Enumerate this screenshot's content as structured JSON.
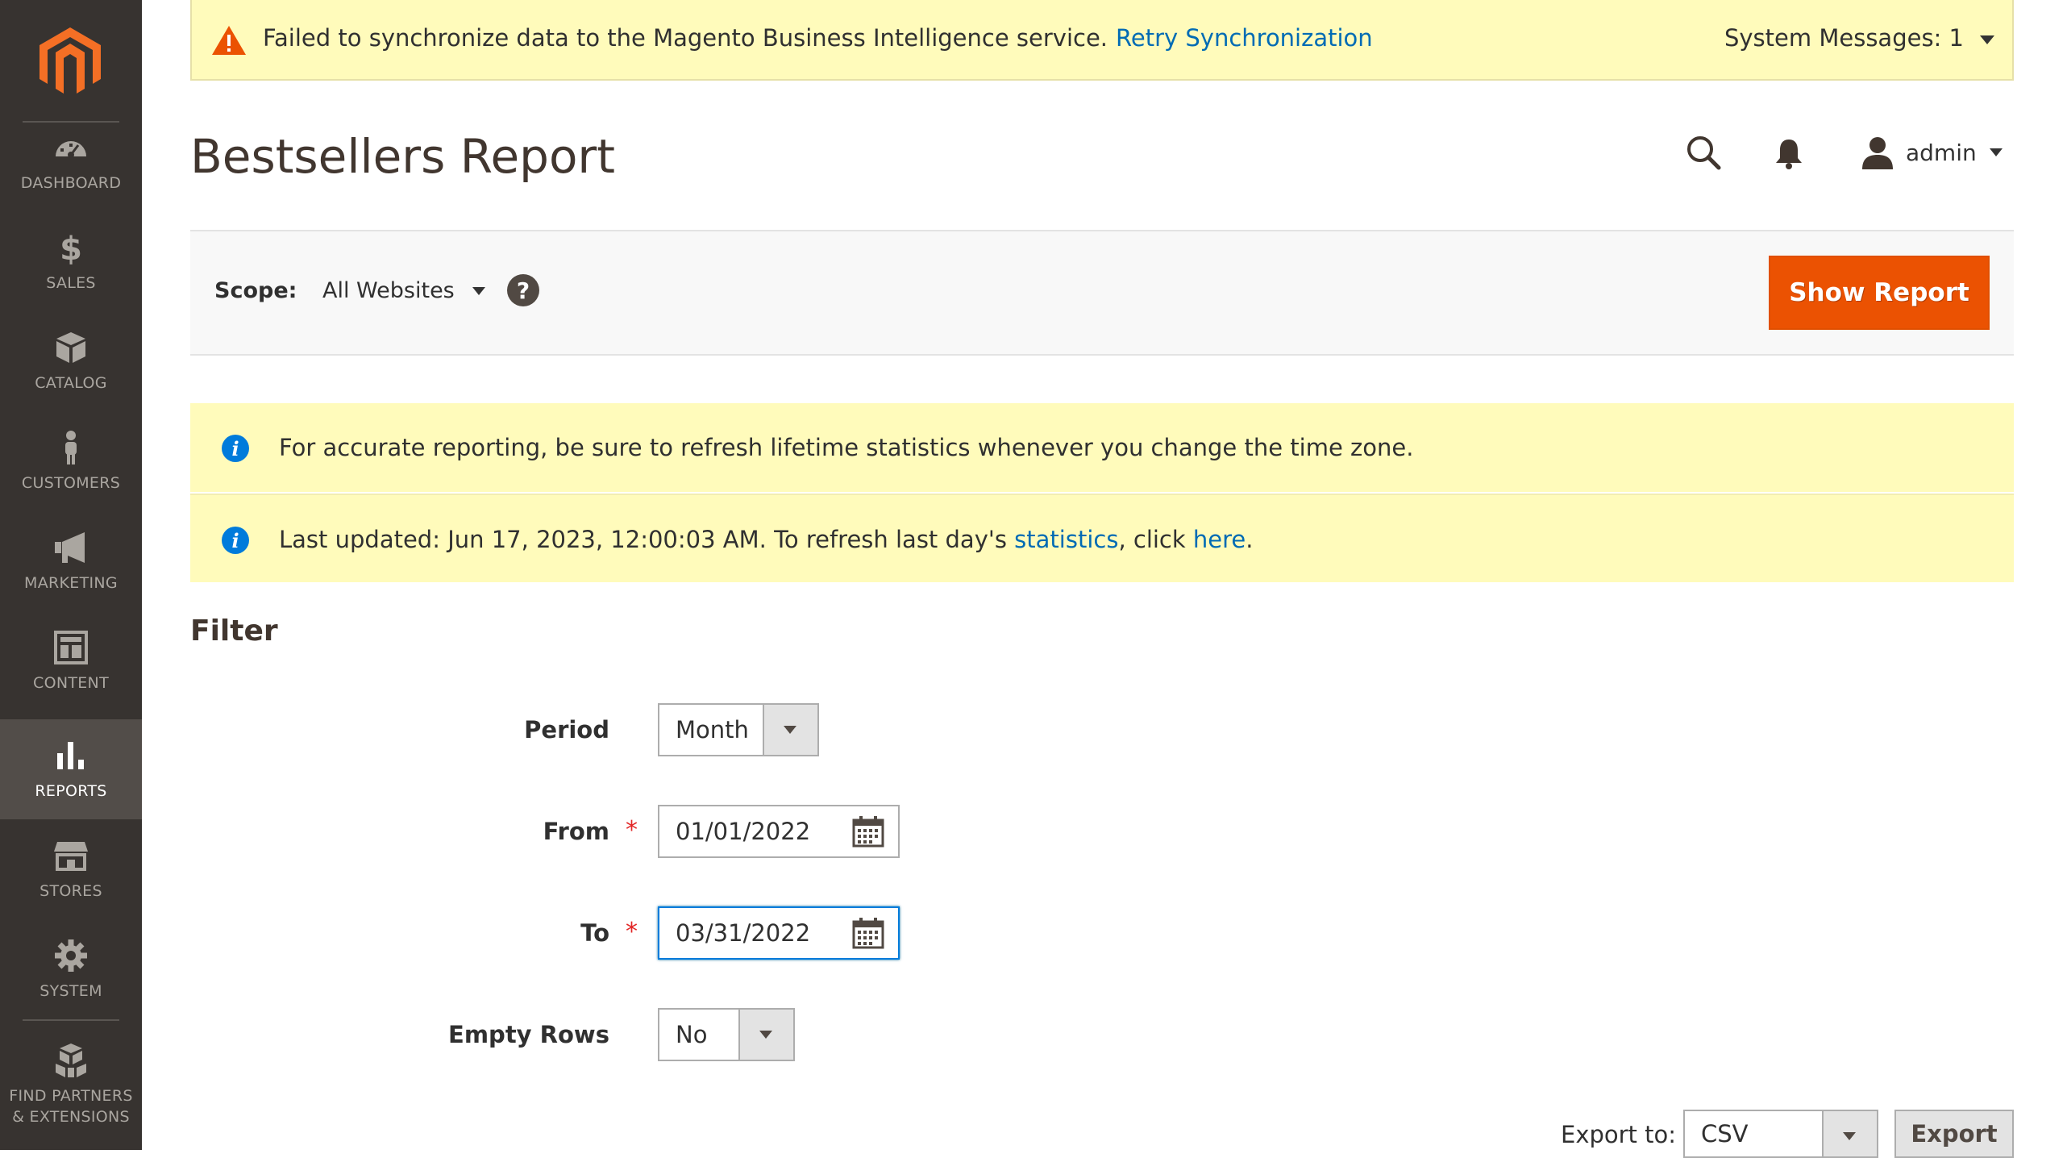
{
  "sidebar": {
    "logo_icon": "magento-logo-icon",
    "items": [
      {
        "label": "DASHBOARD",
        "icon": "dashboard-gauge-icon",
        "active": false
      },
      {
        "label": "SALES",
        "icon": "dollar-icon",
        "active": false
      },
      {
        "label": "CATALOG",
        "icon": "box-icon",
        "active": false
      },
      {
        "label": "CUSTOMERS",
        "icon": "person-icon",
        "active": false
      },
      {
        "label": "MARKETING",
        "icon": "megaphone-icon",
        "active": false
      },
      {
        "label": "CONTENT",
        "icon": "layout-icon",
        "active": false
      },
      {
        "label": "REPORTS",
        "icon": "bar-chart-icon",
        "active": true
      },
      {
        "label": "STORES",
        "icon": "storefront-icon",
        "active": false
      },
      {
        "label": "SYSTEM",
        "icon": "gear-icon",
        "active": false
      },
      {
        "label": "FIND PARTNERS\n& EXTENSIONS",
        "icon": "partners-boxes-icon",
        "active": false
      }
    ]
  },
  "system_message": {
    "text": "Failed to synchronize data to the Magento Business Intelligence service.",
    "link": "Retry Synchronization",
    "count_label": "System Messages: 1"
  },
  "header": {
    "title": "Bestsellers Report",
    "user": "admin"
  },
  "scope": {
    "label": "Scope:",
    "value": "All Websites",
    "show_report": "Show Report"
  },
  "notices": {
    "timezone": "For accurate reporting, be sure to refresh lifetime statistics whenever you change the time zone.",
    "last_updated_prefix": "Last updated: Jun 17, 2023, 12:00:03 AM. To refresh last day's ",
    "statistics_link": "statistics",
    "click_text": ", click ",
    "here_link": "here",
    "period_end": "."
  },
  "filter": {
    "title": "Filter",
    "period_label": "Period",
    "period_value": "Month",
    "from_label": "From",
    "from_value": "01/01/2022",
    "to_label": "To",
    "to_value": "03/31/2022",
    "required_mark": "*",
    "empty_rows_label": "Empty Rows",
    "empty_rows_value": "No"
  },
  "export": {
    "label": "Export to:",
    "format": "CSV",
    "button": "Export"
  },
  "colors": {
    "sidebar_bg": "#373330",
    "sidebar_active": "#524d49",
    "accent_orange": "#eb5202",
    "notice_bg": "#fffbbb",
    "link_blue": "#006bb4"
  }
}
